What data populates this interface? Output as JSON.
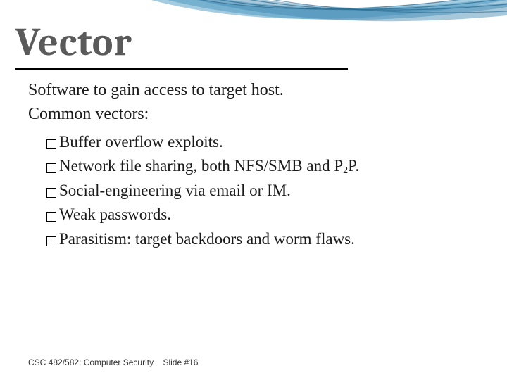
{
  "title": "Vector",
  "intro": {
    "line1": "Software to gain access to target host.",
    "line2": "Common vectors:"
  },
  "bullets": [
    "Buffer overflow exploits.",
    "Network file sharing, both NFS/SMB and P2P.",
    "Social-engineering via email or IM.",
    "Weak passwords.",
    "Parasitism: target backdoors and worm flaws."
  ],
  "footer": {
    "course": "CSC 482/582: Computer Security",
    "slide": "Slide #16"
  }
}
